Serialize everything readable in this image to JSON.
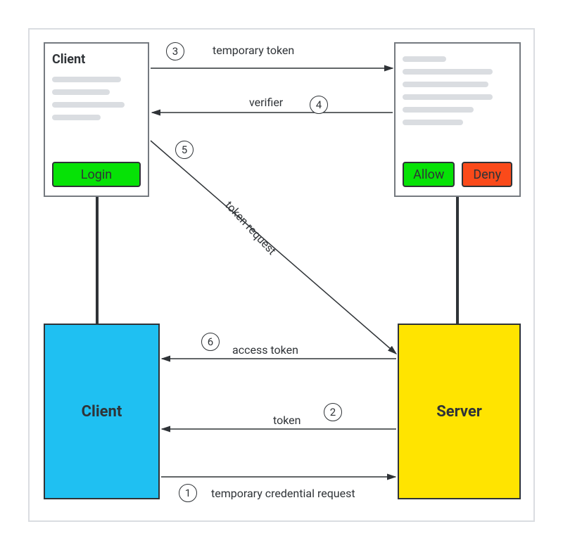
{
  "panels": {
    "top_left_title": "Client",
    "login_label": "Login",
    "allow_label": "Allow",
    "deny_label": "Deny"
  },
  "blocks": {
    "client_label": "Client",
    "server_label": "Server"
  },
  "steps": {
    "s1": {
      "num": "1",
      "label": "temporary credential request"
    },
    "s2": {
      "num": "2",
      "label": "token"
    },
    "s3": {
      "num": "3",
      "label": "temporary token"
    },
    "s4": {
      "num": "4",
      "label": "verifier"
    },
    "s5": {
      "num": "5",
      "label": "token request"
    },
    "s6": {
      "num": "6",
      "label": "access token"
    }
  },
  "colors": {
    "green": "#06e206",
    "orange": "#fa4a1a",
    "cyan": "#1fc0f2",
    "yellow": "#ffe400",
    "frame": "#dadde1",
    "stroke": "#2f3337"
  }
}
